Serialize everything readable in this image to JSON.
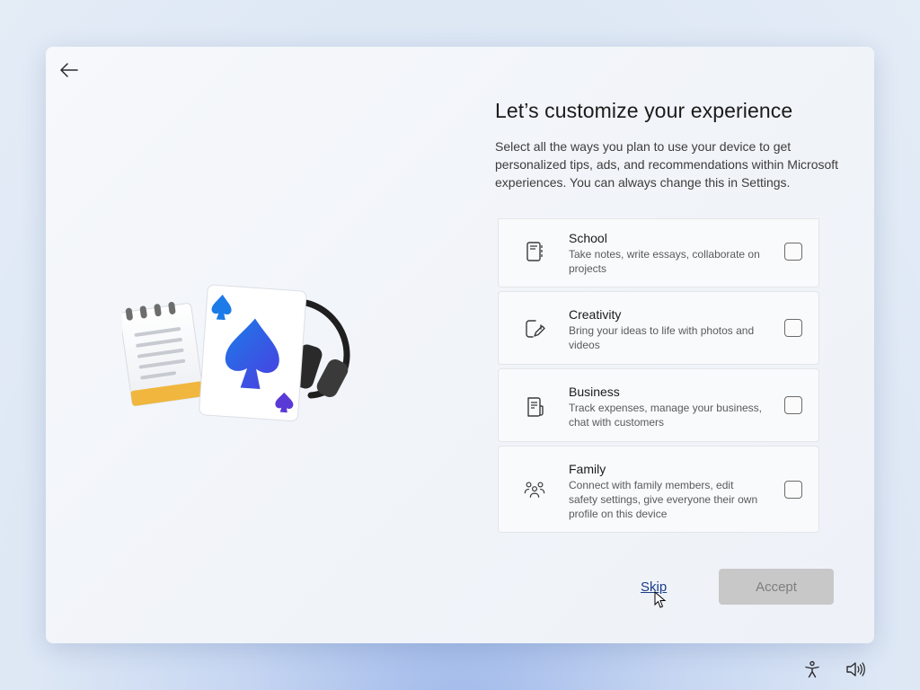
{
  "page": {
    "title": "Let’s customize your experience",
    "description": "Select all the ways you plan to use your device to get personalized tips, ads, and recommendations within Microsoft experiences. You can always change this in Settings."
  },
  "options": [
    {
      "title": "School",
      "description": "Take notes, write essays, collaborate on projects",
      "icon": "notebook-icon",
      "checked": false
    },
    {
      "title": "Creativity",
      "description": "Bring your ideas to life with photos and videos",
      "icon": "pen-edit-icon",
      "checked": false
    },
    {
      "title": "Business",
      "description": "Track expenses, manage your business, chat with customers",
      "icon": "receipt-icon",
      "checked": false
    },
    {
      "title": "Family",
      "description": "Connect with family members, edit safety settings, give everyone their own profile on this device",
      "icon": "people-icon",
      "checked": false
    }
  ],
  "actions": {
    "skip_label": "Skip",
    "accept_label": "Accept",
    "accept_enabled": false
  },
  "system_tray": {
    "icons": [
      "accessibility-icon",
      "volume-icon"
    ]
  },
  "colors": {
    "accent_link": "#1a3c88",
    "accept_disabled_bg": "#c8c8c8",
    "spade_blue": "#2f5fe0"
  }
}
